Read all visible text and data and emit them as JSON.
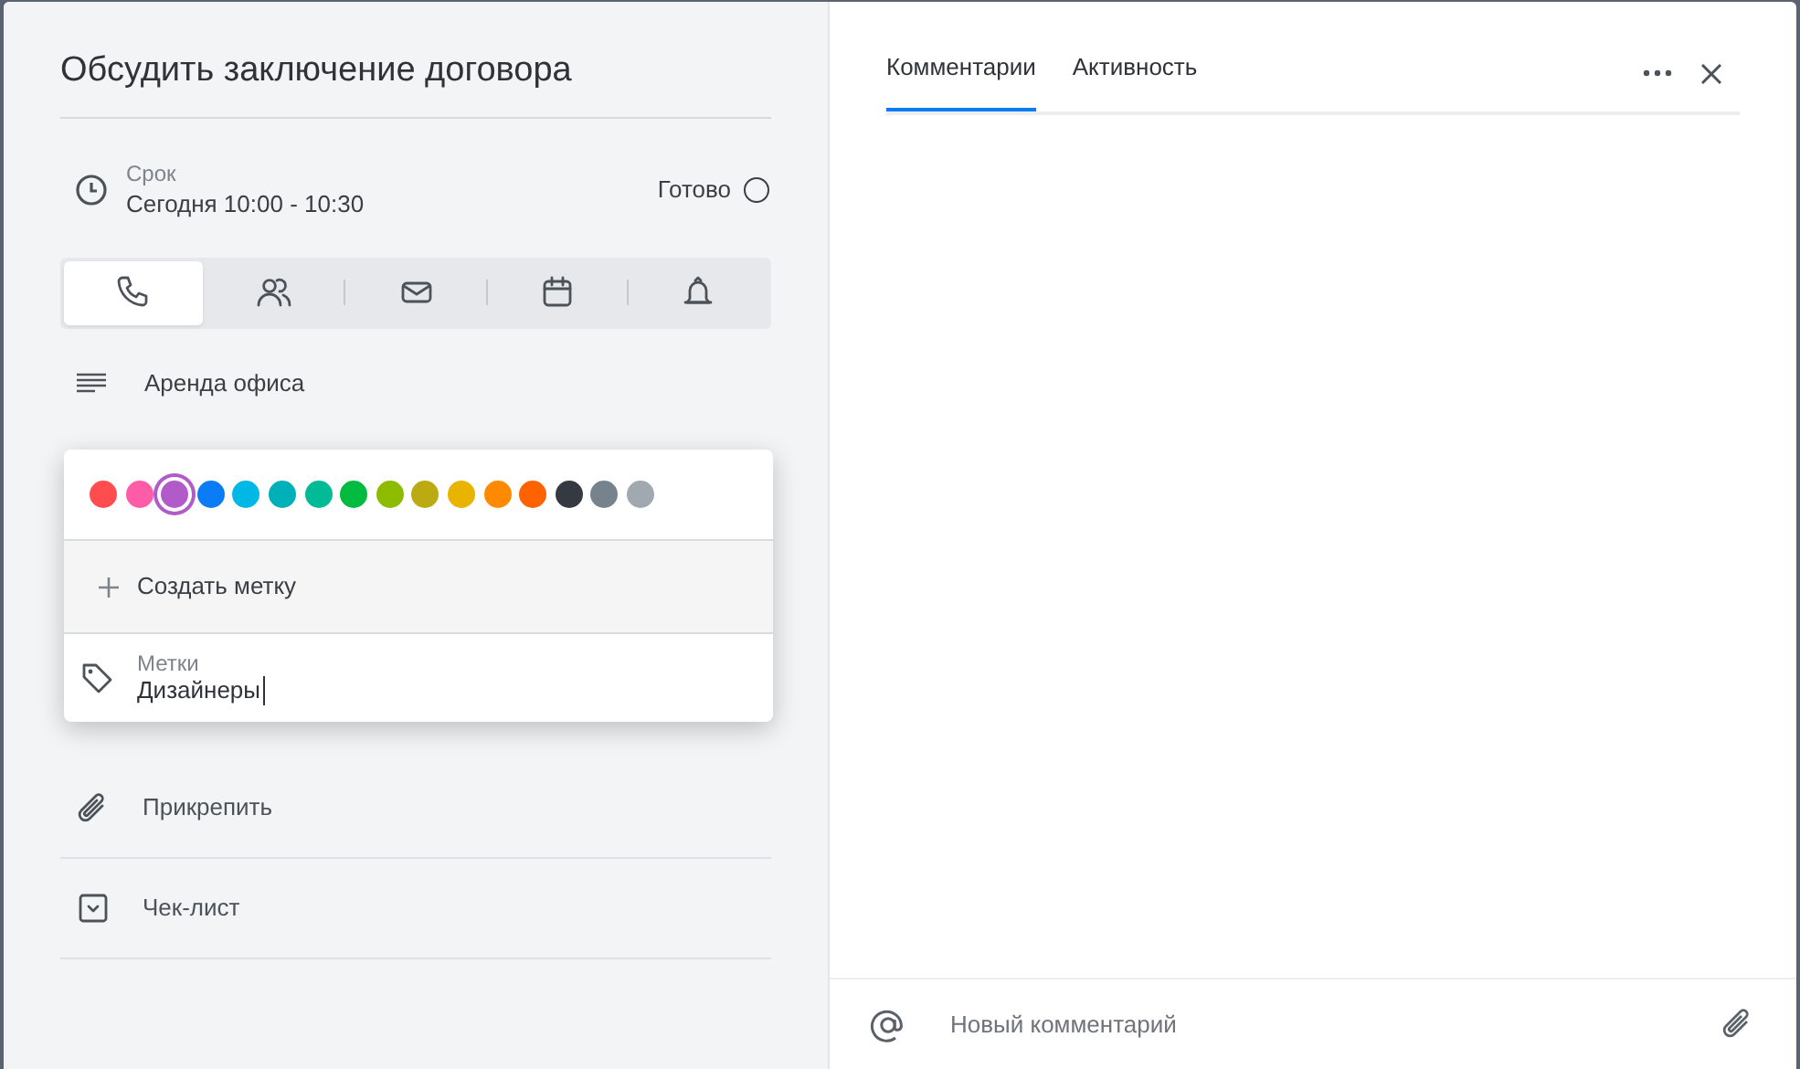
{
  "task": {
    "title": "Обсудить заключение договора",
    "deadline_label": "Срок",
    "deadline": "Сегодня 10:00 - 10:30",
    "done_label": "Готово",
    "done": false
  },
  "activity_types": [
    {
      "kind": "phone",
      "selected": true
    },
    {
      "kind": "people",
      "selected": false
    },
    {
      "kind": "mail",
      "selected": false
    },
    {
      "kind": "calendar",
      "selected": false
    },
    {
      "kind": "bell",
      "selected": false
    }
  ],
  "description": "Аренда офиса",
  "label_popup": {
    "colors": [
      {
        "color": "#ff4d4f",
        "selected": false
      },
      {
        "color": "#ff5ca8",
        "selected": false
      },
      {
        "color": "#b05bc9",
        "selected": true
      },
      {
        "color": "#0a7cf5",
        "selected": false
      },
      {
        "color": "#00b8e6",
        "selected": false
      },
      {
        "color": "#00b0b9",
        "selected": false
      },
      {
        "color": "#00bb96",
        "selected": false
      },
      {
        "color": "#00bb40",
        "selected": false
      },
      {
        "color": "#8cbb00",
        "selected": false
      },
      {
        "color": "#bbaa12",
        "selected": false
      },
      {
        "color": "#e8b400",
        "selected": false
      },
      {
        "color": "#ff8a00",
        "selected": false
      },
      {
        "color": "#ff6200",
        "selected": false
      },
      {
        "color": "#343a40",
        "selected": false
      },
      {
        "color": "#76828c",
        "selected": false
      },
      {
        "color": "#a0a8b0",
        "selected": false
      }
    ],
    "create_label": "Создать метку",
    "field_label": "Метки",
    "field_value": "Дизайнеры"
  },
  "actions": [
    {
      "kind": "attach",
      "label": "Прикрепить"
    },
    {
      "kind": "checklist",
      "label": "Чек-лист"
    }
  ],
  "side_tabs": [
    {
      "label": "Комментарии",
      "selected": true
    },
    {
      "label": "Активность",
      "selected": false
    }
  ],
  "comment": {
    "placeholder": "Новый комментарий"
  }
}
